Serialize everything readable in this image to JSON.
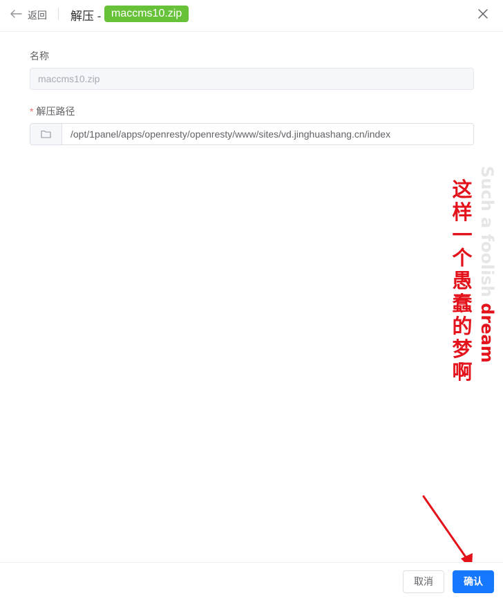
{
  "header": {
    "back_label": "返回",
    "title_prefix": "解压 -",
    "file_tag": "maccms10.zip"
  },
  "form": {
    "name_label": "名称",
    "name_value": "maccms10.zip",
    "path_required_mark": "*",
    "path_label": "解压路径",
    "path_value": "/opt/1panel/apps/openresty/openresty/www/sites/vd.jinghuashang.cn/index"
  },
  "overlay": {
    "chinese_caption": "这样一个愚蠢的梦啊",
    "english_caption_light": "Such a foolish",
    "english_caption_dark": "dream"
  },
  "footer": {
    "cancel_label": "取消",
    "confirm_label": "确认"
  },
  "colors": {
    "tag_green": "#67c23a",
    "primary_blue": "#1677ff",
    "overlay_red": "#e3121b"
  },
  "icons": {
    "back": "arrow-left-icon",
    "close": "close-icon",
    "folder": "folder-icon"
  }
}
